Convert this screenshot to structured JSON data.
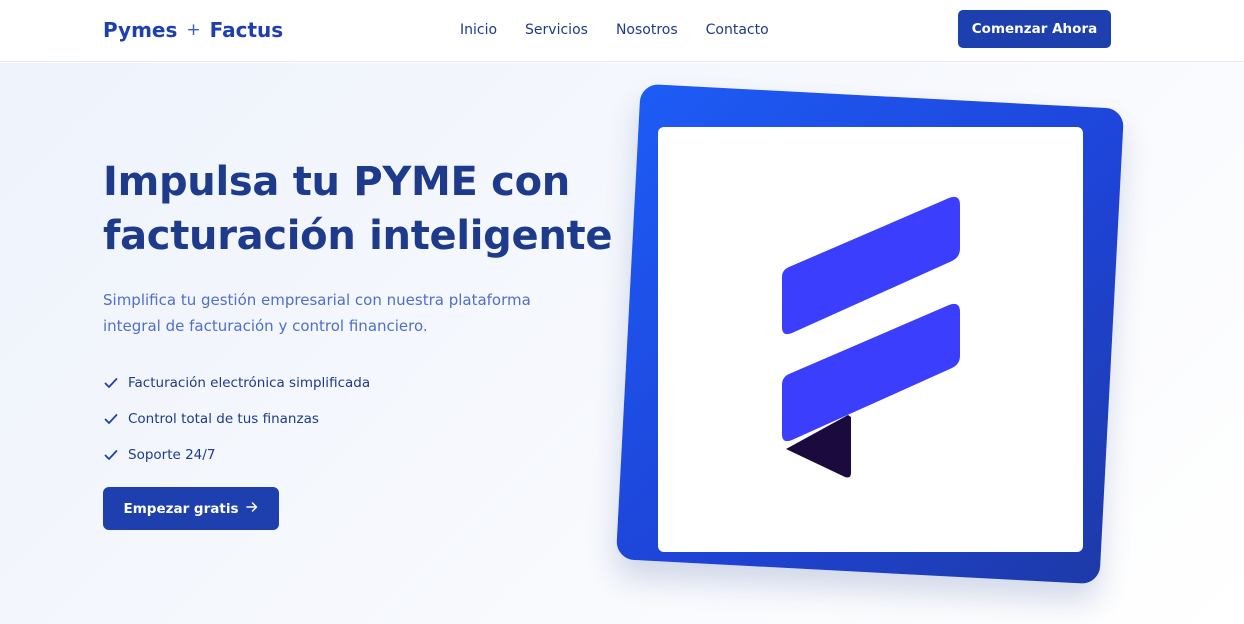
{
  "nav": {
    "brand_left": "Pymes",
    "brand_plus": "+",
    "brand_right": "Factus",
    "links": [
      "Inicio",
      "Servicios",
      "Nosotros",
      "Contacto"
    ],
    "cta": "Comenzar Ahora"
  },
  "hero": {
    "title": "Impulsa tu PYME con facturación inteligente",
    "subtitle": "Simplifica tu gestión empresarial con nuestra plataforma integral de facturación y control financiero.",
    "features": [
      "Facturación electrónica simplificada",
      "Control total de tus finanzas",
      "Soporte 24/7"
    ],
    "cta": "Empezar gratis",
    "cta_icon": "arrow-right-icon",
    "feature_icon": "check-icon"
  },
  "colors": {
    "primary": "#1e40af",
    "heading": "#1e3a8a",
    "subtitle": "#4f6fc9",
    "logo_blue": "#3b3ffd",
    "logo_dark": "#1a0a3d"
  }
}
